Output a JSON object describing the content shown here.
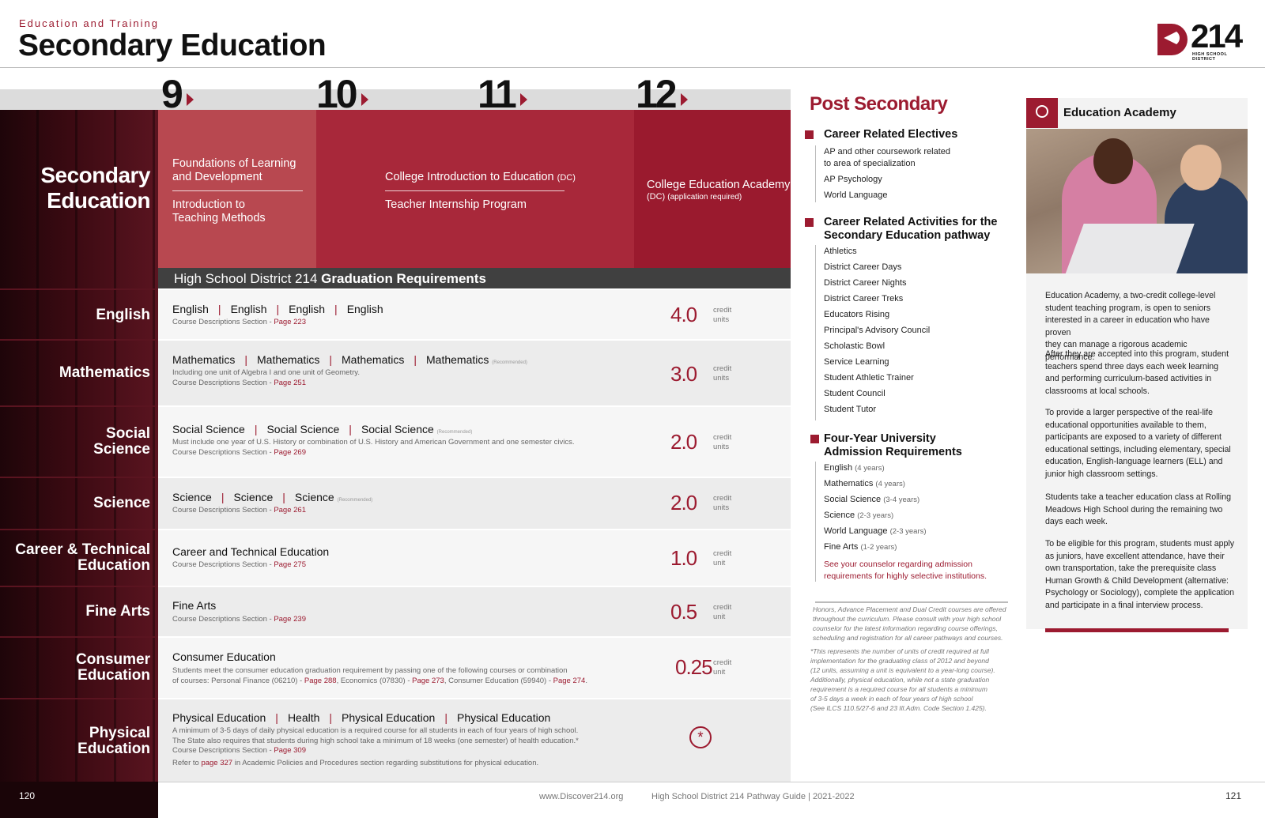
{
  "header": {
    "subtitle": "Education and Training",
    "title": "Secondary Education",
    "logo_number": "214",
    "logo_text": "HIGH SCHOOL DISTRICT"
  },
  "grades": [
    "9",
    "10",
    "11",
    "12"
  ],
  "left_label": {
    "line1": "Secondary",
    "line2": "Education"
  },
  "tracks": {
    "g9_a1": "Foundations of Learning",
    "g9_a2": "and Development",
    "g9_b1": "Introduction to",
    "g9_b2": "Teaching Methods",
    "g10_11_a": "College Introduction to Education",
    "g10_11_a_dc": "(DC)",
    "g10_11_b": "Teacher Internship Program",
    "g12_a": "College Education Academy",
    "g12_b_dc": "(DC)",
    "g12_b": "(application required)"
  },
  "grad_req": {
    "prefix": "High School District 214",
    "bold": "Graduation Requirements"
  },
  "rows": [
    {
      "label": "English",
      "courses": [
        "English",
        "English",
        "English",
        "English"
      ],
      "note_prefix": "Course Descriptions Section - ",
      "note_page": "Page 223",
      "credits": "4.0",
      "unit_1": "credit",
      "unit_2": "units"
    },
    {
      "label": "Mathematics",
      "courses": [
        "Mathematics",
        "Mathematics",
        "Mathematics",
        "Mathematics"
      ],
      "recommended": "(Recommended)",
      "note1": "Including one unit of Algebra I and one unit of Geometry.",
      "note_prefix": "Course Descriptions Section - ",
      "note_page": "Page 251",
      "credits": "3.0",
      "unit_1": "credit",
      "unit_2": "units"
    },
    {
      "label_1": "Social",
      "label_2": "Science",
      "courses": [
        "Social Science",
        "Social Science",
        "Social Science"
      ],
      "recommended": "(Recommended)",
      "note1": "Must include one year of U.S. History or combination of U.S. History and American Government and one semester civics.",
      "note_prefix": "Course Descriptions Section - ",
      "note_page": "Page 269",
      "credits": "2.0",
      "unit_1": "credit",
      "unit_2": "units"
    },
    {
      "label": "Science",
      "courses": [
        "Science",
        "Science",
        "Science"
      ],
      "recommended": "(Recommended)",
      "note_prefix": "Course Descriptions Section - ",
      "note_page": "Page 261",
      "credits": "2.0",
      "unit_1": "credit",
      "unit_2": "units"
    },
    {
      "label_1": "Career & Technical",
      "label_2": "Education",
      "courses": [
        "Career and Technical Education"
      ],
      "note_prefix": "Course Descriptions Section - ",
      "note_page": "Page 275",
      "credits": "1.0",
      "unit_1": "credit",
      "unit_2": "unit"
    },
    {
      "label": "Fine Arts",
      "courses": [
        "Fine Arts"
      ],
      "note_prefix": "Course Descriptions Section - ",
      "note_page": "Page 239",
      "credits": "0.5",
      "unit_1": "credit",
      "unit_2": "unit"
    },
    {
      "label_1": "Consumer",
      "label_2": "Education",
      "courses": [
        "Consumer Education"
      ],
      "note1": "Students meet the consumer education graduation requirement by passing one of the following courses or combination",
      "note2_a": "of courses: Personal Finance (06210) - ",
      "note2_p1": "Page 288",
      "note2_b": ", Economics (07830) - ",
      "note2_p2": "Page 273",
      "note2_c": ", Consumer Education (59940) - ",
      "note2_p3": "Page 274",
      "note2_d": ".",
      "credits": "0.25",
      "unit_1": "credit",
      "unit_2": "unit"
    },
    {
      "label_1": "Physical",
      "label_2": "Education",
      "courses": [
        "Physical Education",
        "Health",
        "Physical Education",
        "Physical Education"
      ],
      "note1": "A minimum of 3-5 days of daily physical education is a required course for all students in each of four years of high school.",
      "note2": "The State also requires that students during high school take a minimum of 18 weeks (one semester) of health education.*",
      "note_prefix": "Course Descriptions Section - ",
      "note_page": "Page 309",
      "note4_a": "Refer to ",
      "note4_p": "page 327",
      "note4_b": " in Academic Policies and Procedures section regarding substitutions for physical education.",
      "star": "*"
    }
  ],
  "post_secondary": {
    "title": "Post Secondary",
    "electives": {
      "heading": "Career Related Electives",
      "items": [
        "AP and other coursework related",
        "to area of specialization",
        "AP Psychology",
        "World Language"
      ]
    },
    "activities": {
      "heading_1": "Career Related Activities for the",
      "heading_2": "Secondary Education pathway",
      "items": [
        "Athletics",
        "District Career Days",
        "District Career Nights",
        "District Career Treks",
        "Educators Rising",
        "Principal's Advisory Council",
        "Scholastic Bowl",
        "Service Learning",
        "Student Athletic Trainer",
        "Student Council",
        "Student Tutor"
      ]
    },
    "university": {
      "heading_1": "Four-Year University",
      "heading_2": "Admission Requirements",
      "items": [
        {
          "name": "English",
          "years": "(4 years)"
        },
        {
          "name": "Mathematics",
          "years": "(4 years)"
        },
        {
          "name": "Social Science",
          "years": "(3-4 years)"
        },
        {
          "name": "Science",
          "years": "(2-3 years)"
        },
        {
          "name": "World Language",
          "years": "(2-3 years)"
        },
        {
          "name": "Fine Arts",
          "years": "(1-2 years)"
        }
      ],
      "note_1": "See your counselor regarding admission",
      "note_2": "requirements for highly selective institutions."
    },
    "footnote1": [
      "Honors, Advance Placement and Dual Credit courses are offered",
      "throughout the curriculum. Please consult with your high school",
      "counselor for the latest information regarding course offerings,",
      "scheduling and registration for all career pathways and courses."
    ],
    "footnote2": [
      "*This represents the number of units of credit required at full",
      "implementation for the graduating class of 2012 and beyond",
      "(12 units, assuming a unit is equivalent to a year-long course).",
      "Additionally, physical education, while not a state graduation",
      "requirement is a required course for all students a minimum",
      "of 3-5 days a week in each of four years of high school",
      "(See ILCS 110.5/27-6 and 23 Ill.Adm. Code Section 1.425)."
    ]
  },
  "academy": {
    "title": "Education Academy",
    "paragraphs": [
      [
        "Education Academy, a two-credit college-level",
        "student teaching program, is open to seniors",
        "interested in a career in education who have proven",
        "they can manage a rigorous academic performance."
      ],
      [
        "After they are accepted into this program, student",
        "teachers spend three days each week learning",
        "and performing curriculum-based activities in",
        "classrooms at local schools."
      ],
      [
        "To provide a larger perspective of the real-life",
        "educational opportunities available to them,",
        "participants are exposed to a variety of different",
        "educational settings, including elementary, special",
        "education, English-language learners (ELL) and",
        "junior high classroom settings."
      ],
      [
        "Students take a teacher education class at Rolling",
        "Meadows High School during the remaining two",
        "days each week."
      ],
      [
        "To be eligible for this program, students must apply",
        "as juniors, have excellent attendance, have their",
        "own transportation, take the prerequisite class",
        "Human Growth & Child Development (alternative:",
        "Psychology or Sociology), complete the application",
        "and participate in a final interview process."
      ]
    ]
  },
  "footer": {
    "page_left": "120",
    "page_right": "121",
    "url": "www.Discover214.org",
    "guide": "High School District 214 Pathway Guide  |  2021-2022"
  },
  "colors": {
    "accent": "#9c1b30",
    "dark": "#404040"
  }
}
